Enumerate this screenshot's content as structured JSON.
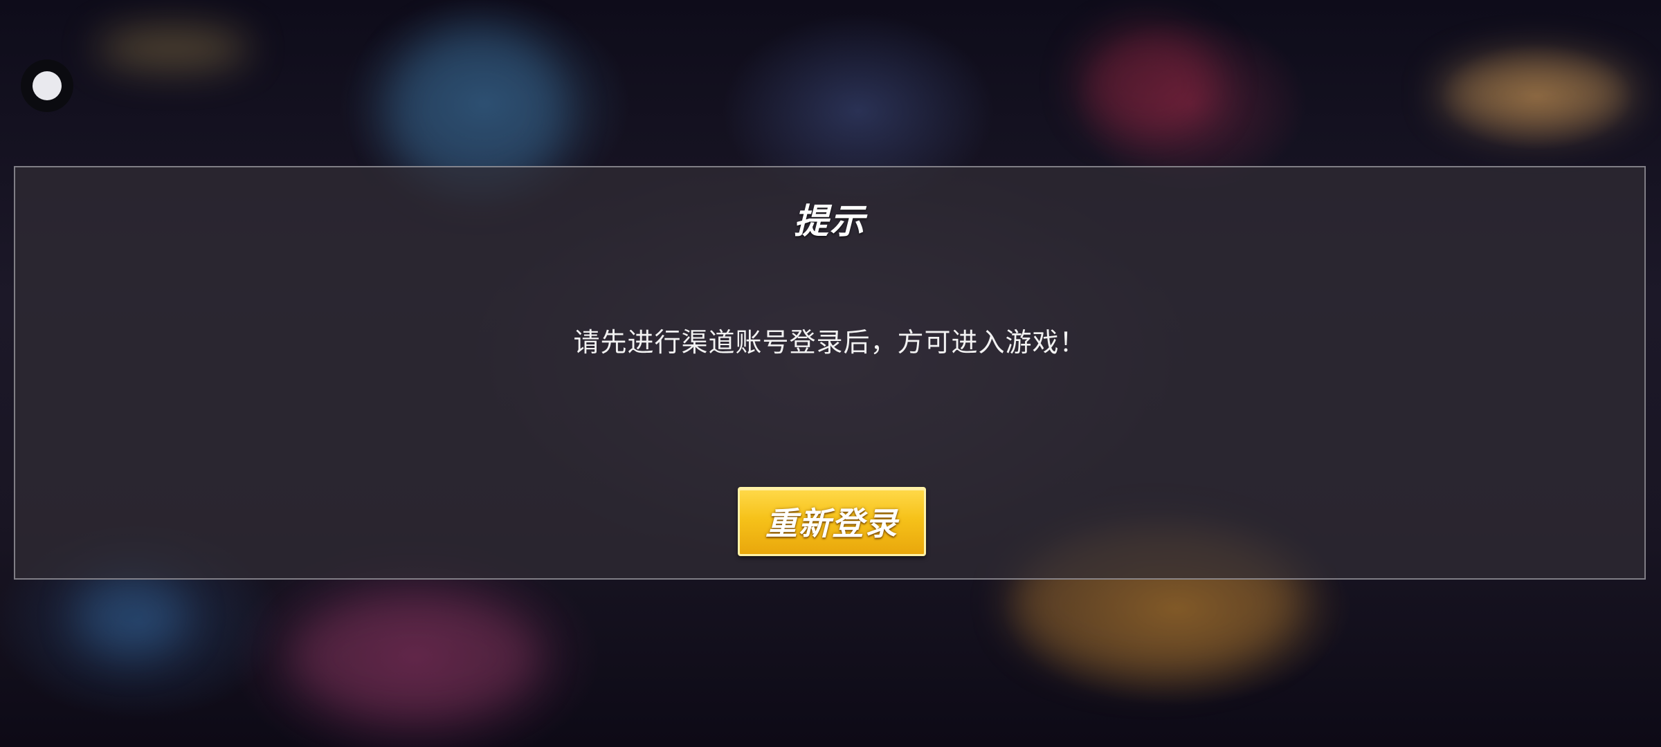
{
  "dialog": {
    "title": "提示",
    "message": "请先进行渠道账号登录后，方可进入游戏！",
    "relogin_button_label": "重新登录"
  },
  "colors": {
    "button_accent": "#f6c21a",
    "dialog_background": "#302c34",
    "text": "#ffffff"
  },
  "icons": {
    "floating_button": "floating-menu-dot-icon"
  }
}
